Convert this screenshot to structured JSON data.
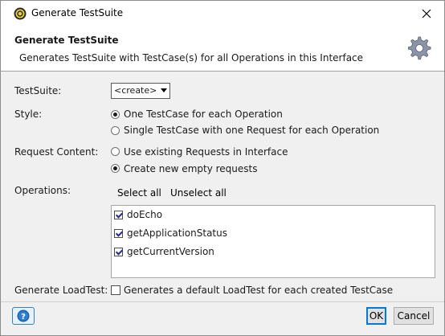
{
  "window": {
    "title": "Generate TestSuite"
  },
  "header": {
    "title": "Generate TestSuite",
    "description": "Generates TestSuite with TestCase(s) for all Operations in this Interface"
  },
  "form": {
    "testsuite_label": "TestSuite:",
    "testsuite_value": "<create>",
    "style_label": "Style:",
    "style_options": [
      "One TestCase for each Operation",
      "Single TestCase with one Request for each Operation"
    ],
    "style_selected": 0,
    "request_content_label": "Request Content:",
    "request_content_options": [
      "Use existing Requests in Interface",
      "Create new empty requests"
    ],
    "request_content_selected": 1,
    "operations_label": "Operations:",
    "select_all_label": "Select all",
    "unselect_all_label": "Unselect all",
    "operations": [
      {
        "name": "doEcho",
        "checked": true
      },
      {
        "name": "getApplicationStatus",
        "checked": true
      },
      {
        "name": "getCurrentVersion",
        "checked": true
      }
    ],
    "loadtest_label": "Generate LoadTest:",
    "loadtest_option": "Generates a default LoadTest for each created TestCase",
    "loadtest_checked": false
  },
  "footer": {
    "ok_label": "OK",
    "cancel_label": "Cancel"
  },
  "icons": [
    "app-icon",
    "close-icon",
    "gear-icon",
    "help-icon"
  ]
}
